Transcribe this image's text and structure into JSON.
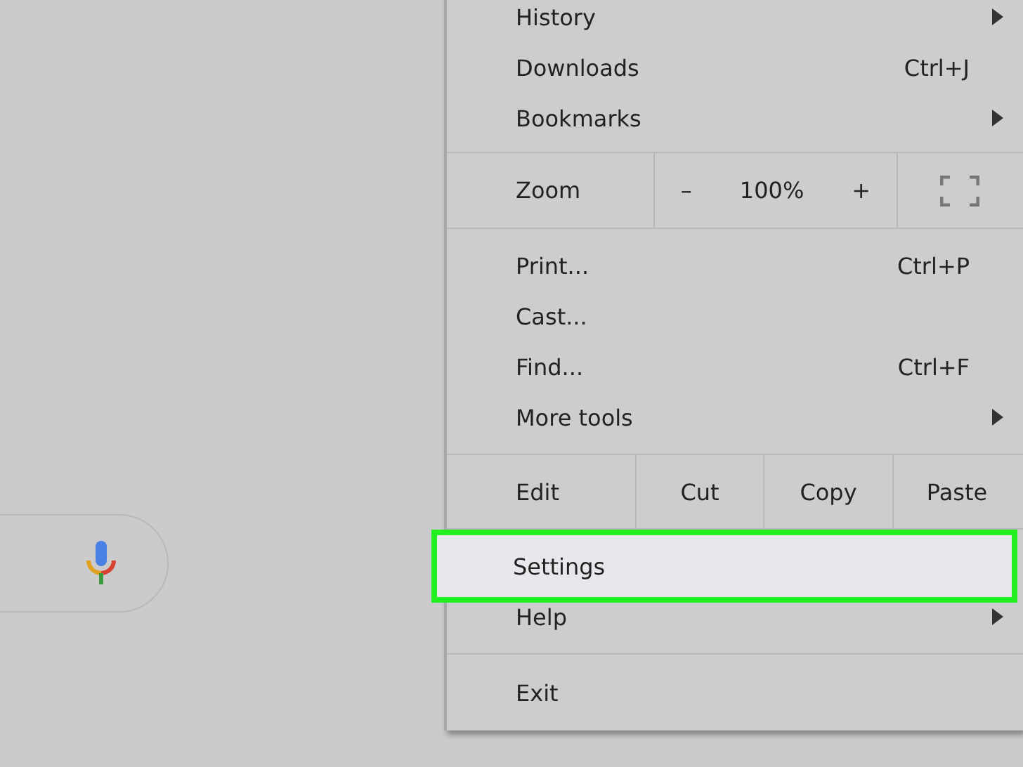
{
  "menu": {
    "sections": [
      {
        "rows": [
          {
            "kind": "item",
            "label": "History",
            "has_submenu": true,
            "selected": false
          },
          {
            "kind": "item",
            "label": "Downloads",
            "shortcut": "Ctrl+J",
            "has_submenu": false,
            "selected": false
          },
          {
            "kind": "item",
            "label": "Bookmarks",
            "has_submenu": true,
            "selected": false
          }
        ]
      },
      {
        "rows": [
          {
            "kind": "zoom",
            "label": "Zoom",
            "minus": "–",
            "value": "100%",
            "plus": "+"
          }
        ]
      },
      {
        "rows": [
          {
            "kind": "item",
            "label": "Print...",
            "shortcut": "Ctrl+P",
            "has_submenu": false,
            "selected": false
          },
          {
            "kind": "item",
            "label": "Cast...",
            "has_submenu": false,
            "selected": false
          },
          {
            "kind": "item",
            "label": "Find...",
            "shortcut": "Ctrl+F",
            "has_submenu": false,
            "selected": false
          },
          {
            "kind": "item",
            "label": "More tools",
            "has_submenu": true,
            "selected": false
          }
        ]
      },
      {
        "rows": [
          {
            "kind": "edit",
            "label": "Edit",
            "cut": "Cut",
            "copy": "Copy",
            "paste": "Paste"
          }
        ]
      },
      {
        "rows": [
          {
            "kind": "item",
            "label": "Settings",
            "has_submenu": false,
            "selected": true
          },
          {
            "kind": "item",
            "label": "Help",
            "has_submenu": true,
            "selected": false
          }
        ]
      },
      {
        "rows": [
          {
            "kind": "item",
            "label": "Exit",
            "has_submenu": false,
            "selected": false
          }
        ]
      }
    ]
  }
}
